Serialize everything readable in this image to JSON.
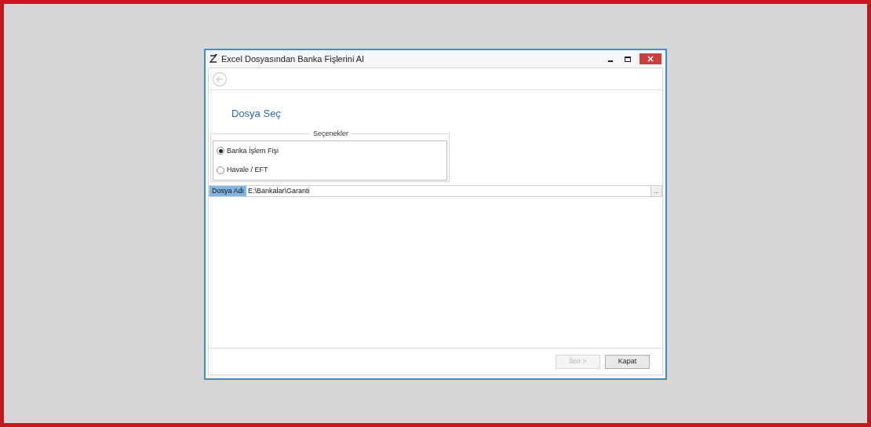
{
  "window": {
    "title": "Excel Dosyasından Banka Fişlerini Al"
  },
  "toolbar": {
    "back_disabled": true
  },
  "heading": "Dosya Seç",
  "options": {
    "title": "Seçenekler",
    "items": [
      {
        "label": "Banka İşlem Fişi",
        "selected": true
      },
      {
        "label": "Havale / EFT",
        "selected": false
      }
    ]
  },
  "file_field": {
    "label": "Dosya Adı",
    "value": "E:\\Bankalar\\Garanti",
    "browse": "..."
  },
  "buttons": [
    {
      "label": "İleri >",
      "disabled": true
    },
    {
      "label": "Kapat",
      "disabled": false
    }
  ]
}
